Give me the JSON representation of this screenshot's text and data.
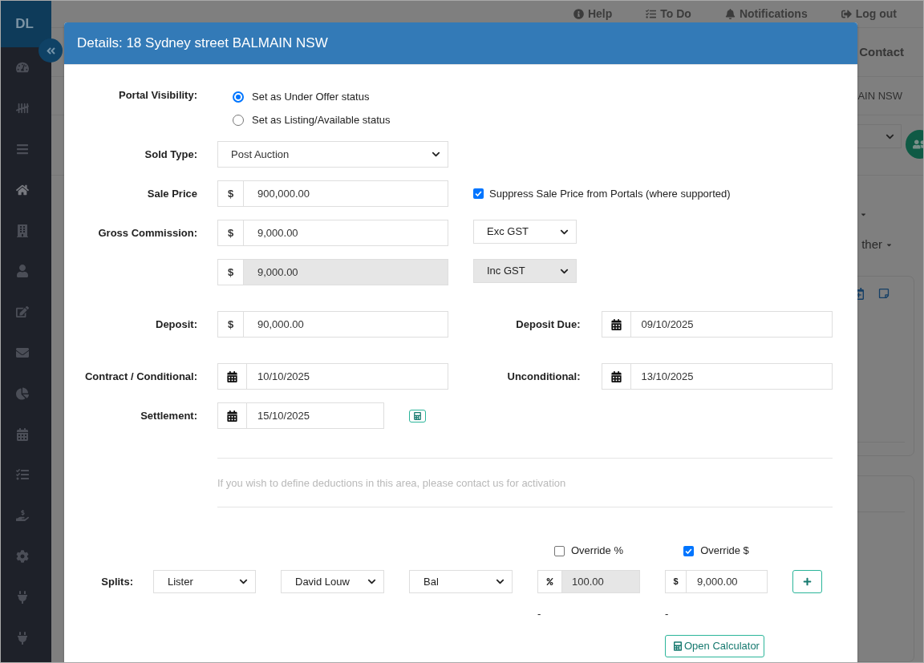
{
  "sidebar": {
    "logo": "DL",
    "items": [
      {
        "selected": false
      },
      {
        "selected": false
      },
      {
        "selected": false
      },
      {
        "selected": true
      },
      {
        "selected": false
      },
      {
        "selected": false
      },
      {
        "selected": false
      },
      {
        "selected": false
      },
      {
        "selected": false
      },
      {
        "selected": false
      },
      {
        "selected": false
      },
      {
        "selected": false
      },
      {
        "selected": false
      },
      {
        "selected": false
      },
      {
        "selected": false
      }
    ]
  },
  "top_nav": [
    {
      "label": "Help"
    },
    {
      "label": "To Do"
    },
    {
      "label": "Notifications"
    },
    {
      "label": "Log out"
    }
  ],
  "background_page": {
    "tab": "Contact",
    "address": "AIN NSW",
    "menu": "ther"
  },
  "modal": {
    "title": "Details: 18 Sydney street BALMAIN NSW",
    "portal_visibility": {
      "label": "Portal Visibility:",
      "options": [
        {
          "label": "Set as Under Offer status",
          "selected": true
        },
        {
          "label": "Set as Listing/Available status",
          "selected": false
        }
      ]
    },
    "sold_type": {
      "label": "Sold Type:",
      "value": "Post Auction"
    },
    "sale_price": {
      "label": "Sale Price",
      "prefix": "$",
      "value": "900,000.00",
      "suppress": {
        "label": "Suppress Sale Price from Portals (where supported)",
        "checked": true
      }
    },
    "gross_commission": {
      "label": "Gross Commission:",
      "rows": [
        {
          "prefix": "$",
          "value": "9,000.00",
          "gst": "Exc GST",
          "disabled": false
        },
        {
          "prefix": "$",
          "value": "9,000.00",
          "gst": "Inc GST",
          "disabled": true
        }
      ]
    },
    "deposit": {
      "label": "Deposit:",
      "prefix": "$",
      "value": "90,000.00"
    },
    "deposit_due": {
      "label": "Deposit Due:",
      "value": "09/10/2025"
    },
    "contract": {
      "label": "Contract / Conditional:",
      "value": "10/10/2025"
    },
    "unconditional": {
      "label": "Unconditional:",
      "value": "13/10/2025"
    },
    "settlement": {
      "label": "Settlement:",
      "value": "15/10/2025"
    },
    "deductions_note": "If you wish to define deductions in this area, please contact us for activation",
    "splits": {
      "label": "Splits:",
      "override_percent": {
        "label": "Override %",
        "checked": false
      },
      "override_amount": {
        "label": "Override $",
        "checked": true
      },
      "rows": [
        {
          "role": "Lister",
          "agent": "David Louw",
          "type": "Bal",
          "percent": "100.00",
          "percent_disabled": true,
          "prefix": "$",
          "amount": "9,000.00",
          "amount_disabled": false
        }
      ],
      "percent_note": "-",
      "amount_note": "-",
      "calculator_button": "Open Calculator"
    }
  }
}
